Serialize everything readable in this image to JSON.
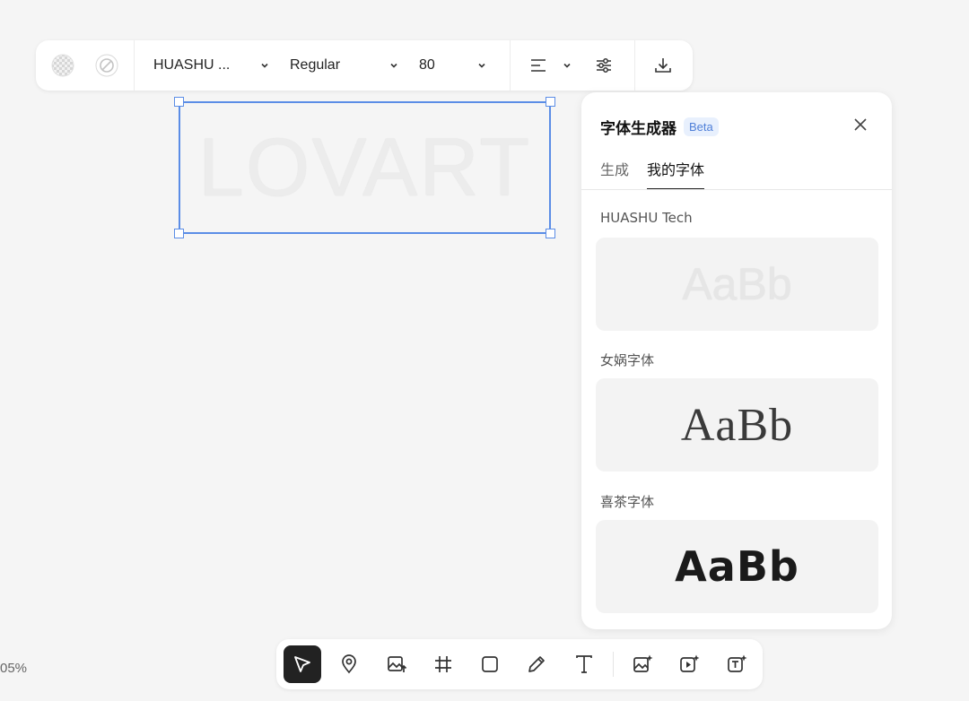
{
  "toolbar": {
    "font_name": "HUASHU ...",
    "font_weight": "Regular",
    "font_size": "80"
  },
  "canvas": {
    "text": "LOVART"
  },
  "panel": {
    "title": "字体生成器",
    "badge": "Beta",
    "tabs": [
      {
        "label": "生成",
        "active": false
      },
      {
        "label": "我的字体",
        "active": true
      }
    ],
    "fonts": [
      {
        "name": "HUASHU Tech",
        "sample": "AaBb"
      },
      {
        "name": "女娲字体",
        "sample": "AaBb"
      },
      {
        "name": "喜茶字体",
        "sample": "AaBb"
      }
    ]
  },
  "bottom_tools": [
    {
      "icon": "select-arrow-icon",
      "active": true
    },
    {
      "icon": "location-pin-icon",
      "active": false
    },
    {
      "icon": "image-upload-icon",
      "active": false
    },
    {
      "icon": "frame-hash-icon",
      "active": false
    },
    {
      "icon": "rectangle-icon",
      "active": false
    },
    {
      "icon": "pencil-icon",
      "active": false
    },
    {
      "icon": "text-icon",
      "active": false
    },
    {
      "icon": "ai-image-icon",
      "active": false
    },
    {
      "icon": "ai-video-icon",
      "active": false
    },
    {
      "icon": "ai-text-icon",
      "active": false
    }
  ],
  "zoom": "05%",
  "colors": {
    "accent": "#5b8de6",
    "beta_bg": "#e8f0fd",
    "beta_text": "#4f7fd8"
  }
}
